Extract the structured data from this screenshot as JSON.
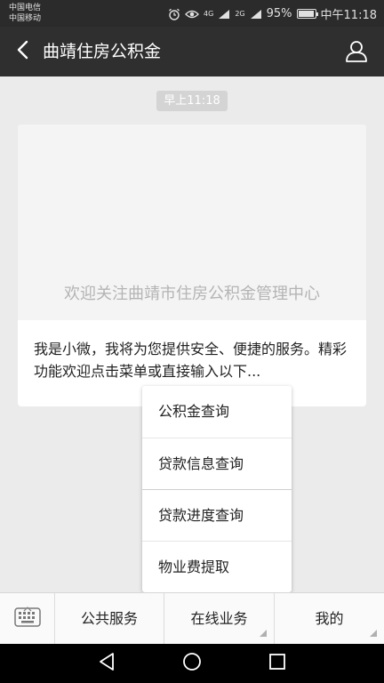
{
  "status_bar": {
    "carriers": [
      "中国电信",
      "中国移动"
    ],
    "network_1": "4G",
    "network_2": "2G",
    "battery": "95%",
    "battery_level": 0.95,
    "time": "中午11:18",
    "icons": [
      "alarm-icon",
      "eye-icon",
      "signal-icon",
      "battery-icon"
    ]
  },
  "title_bar": {
    "title": "曲靖住房公积金",
    "icons": [
      "back-arrow-icon",
      "profile-icon"
    ]
  },
  "chat": {
    "timestamp": "早上11:18",
    "article": {
      "cover_title": "欢迎关注曲靖市住房公积金管理中心",
      "digest": "我是小微，我将为您提供安全、便捷的服务。精彩功能欢迎点击菜单或直接输入以下..."
    }
  },
  "popup_menu": {
    "items": [
      "公积金查询",
      "贷款信息查询",
      "贷款进度查询",
      "物业费提取"
    ]
  },
  "menu_bar": {
    "buttons": [
      "公共服务",
      "在线业务",
      "我的"
    ],
    "icons": [
      "keyboard-icon"
    ]
  },
  "nav_bar": {
    "icons": [
      "nav-back-icon",
      "nav-home-icon",
      "nav-recent-icon"
    ]
  },
  "colors": {
    "header_bg": "#2f2f2f",
    "chat_bg": "#ebebeb",
    "card_bg": "#ffffff",
    "timestamp_chip": "#d4d4d4"
  }
}
